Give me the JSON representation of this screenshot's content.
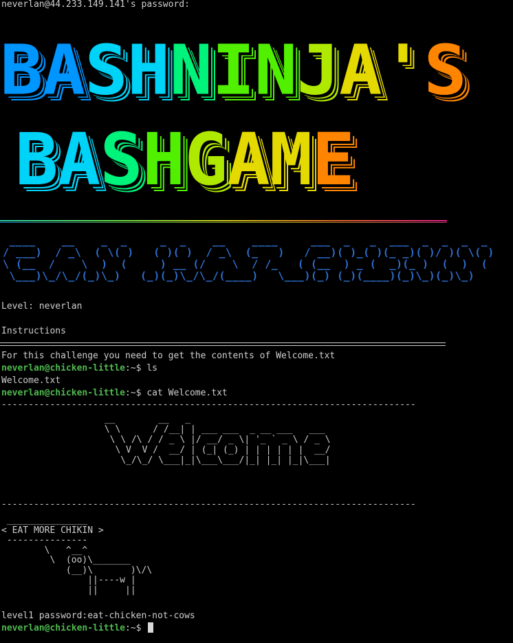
{
  "terminal": {
    "password_prompt": "neverlan@44.233.149.141's password:",
    "banner_line1": "BASHNINJA'S",
    "banner_line2": "BASH GAME",
    "banner_colors": [
      "#1f8ff0",
      "#1fc6e0",
      "#22e08a",
      "#6fe02a",
      "#b6e018",
      "#dcd41a",
      "#e98a1c"
    ],
    "can_haz_art": " ____    __    _  _     _  _    __    ____     ___  _   _  ___  _  _  _  _ \n/ ___)  / _\\  ( \\( )   ( )( )  / _\\  (_   )   / __)( )_( )(_ _)( )/ )( \\( )\n\\ (__  /    \\  )  (     ) __ (/    \\  / /_   ( (__  ) _ (  _)(_ )  (  )  ( \n \\___)\\_/\\_/(_)\\_)   (_)(_)\\_/\\_/(____)   \\___)(_) (_)(____)(_)\\_)(_)\\_)",
    "level_text": "Level: neverlan",
    "instructions_heading": "Instructions",
    "instructions_text": "For this challenge you need to get the contents of Welcome.txt",
    "prompt_user": "neverlan@chicken-little",
    "prompt_path": ":~$",
    "cmd1": " ls",
    "ls_output": "Welcome.txt",
    "cmd2": " cat Welcome.txt",
    "dashes": "-----------------------------------------------------------------------------",
    "welcome_art": " __        __   _                          \n \\ \\      / /__| | ___ ___  _ __ ___   ___ \n  \\ \\ /\\ / / _ \\ |/ __/ _ \\| '_ ` _ \\ / _ \\\n   \\ V  V /  __/ | (_| (_) | | | | | |  __/\n    \\_/\\_/ \\___|_|\\___\\___/|_| |_| |_|\\___|",
    "cow_art": " _______________\n< EAT MORE CHIKIN >\n ---------------\n        \\   ^__^\n         \\  (oo)\\_______\n            (__)\\       )\\/\\\n                ||----w |\n                ||     ||",
    "password_line": "level1 password:eat-chicken-not-cows"
  }
}
